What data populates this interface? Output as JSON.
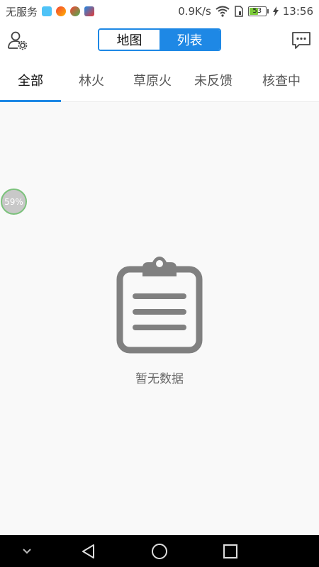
{
  "status_bar": {
    "carrier": "无服务",
    "network_speed": "0.9K/s",
    "battery_level": "53",
    "time": "13:56"
  },
  "header": {
    "segments": [
      {
        "label": "地图",
        "active": false
      },
      {
        "label": "列表",
        "active": true
      }
    ]
  },
  "tabs": [
    {
      "label": "全部",
      "selected": true
    },
    {
      "label": "林火",
      "selected": false
    },
    {
      "label": "草原火",
      "selected": false
    },
    {
      "label": "未反馈",
      "selected": false
    },
    {
      "label": "核查中",
      "selected": false
    }
  ],
  "floating_badge": {
    "text": "59%"
  },
  "empty_state": {
    "text": "暂无数据"
  },
  "colors": {
    "accent": "#1e88e5",
    "background": "#f9f9f9",
    "icon_gray": "#808080"
  }
}
